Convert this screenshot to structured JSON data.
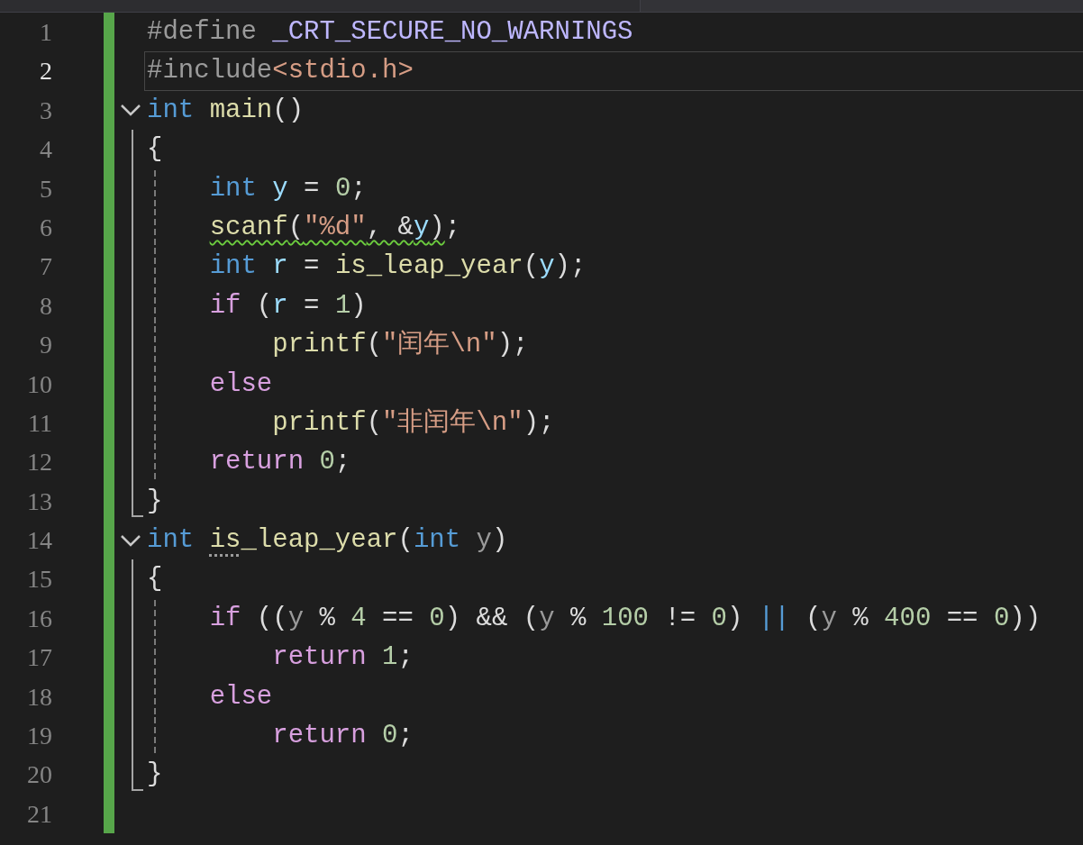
{
  "editor": {
    "lines": [
      {
        "number": "1",
        "current": false,
        "indent_guide": false,
        "tokens": [
          {
            "kind": "pp",
            "text": "#define "
          },
          {
            "kind": "macro",
            "text": "_CRT_SECURE_NO_WARNINGS"
          }
        ]
      },
      {
        "number": "2",
        "current": true,
        "indent_guide": false,
        "tokens": [
          {
            "kind": "pp",
            "text": "#include"
          },
          {
            "kind": "str",
            "text": "<stdio.h>"
          }
        ]
      },
      {
        "number": "3",
        "current": false,
        "indent_guide": false,
        "expanded": true,
        "tokens": [
          {
            "kind": "kw",
            "text": "int "
          },
          {
            "kind": "fn",
            "text": "main"
          },
          {
            "kind": "txt",
            "text": "()"
          }
        ],
        "children": [
          {
            "number": "4",
            "current": false,
            "indent_guide": false,
            "tokens": [
              {
                "kind": "txt",
                "text": "{"
              }
            ]
          },
          {
            "number": "5",
            "current": false,
            "indent_guide": true,
            "tokens": [
              {
                "kind": "kw",
                "text": "    int "
              },
              {
                "kind": "var",
                "text": "y"
              },
              {
                "kind": "txt",
                "text": " = "
              },
              {
                "kind": "num",
                "text": "0"
              },
              {
                "kind": "txt",
                "text": ";"
              }
            ]
          },
          {
            "number": "6",
            "current": false,
            "indent_guide": true,
            "tokens": [
              {
                "kind": "fn",
                "text": "    scanf",
                "warning": true
              },
              {
                "kind": "txt",
                "text": "(",
                "warning": true
              },
              {
                "kind": "str",
                "text": "\"%d\"",
                "warning": true
              },
              {
                "kind": "txt",
                "text": ", &",
                "warning": true
              },
              {
                "kind": "var",
                "text": "y",
                "warning": true
              },
              {
                "kind": "txt",
                "text": ")",
                "warning": true
              },
              {
                "kind": "txt",
                "text": ";",
                "warning": false
              }
            ]
          },
          {
            "number": "7",
            "current": false,
            "indent_guide": true,
            "tokens": [
              {
                "kind": "kw",
                "text": "    int "
              },
              {
                "kind": "var",
                "text": "r"
              },
              {
                "kind": "txt",
                "text": " = "
              },
              {
                "kind": "fn",
                "text": "is_leap_year"
              },
              {
                "kind": "txt",
                "text": "("
              },
              {
                "kind": "var",
                "text": "y"
              },
              {
                "kind": "txt",
                "text": ");"
              }
            ]
          },
          {
            "number": "8",
            "current": false,
            "indent_guide": true,
            "tokens": [
              {
                "kind": "ctl",
                "text": "    if"
              },
              {
                "kind": "txt",
                "text": " ("
              },
              {
                "kind": "var",
                "text": "r"
              },
              {
                "kind": "txt",
                "text": " = "
              },
              {
                "kind": "num",
                "text": "1"
              },
              {
                "kind": "txt",
                "text": ")"
              }
            ]
          },
          {
            "number": "9",
            "current": false,
            "indent_guide": true,
            "tokens": [
              {
                "kind": "fn",
                "text": "        printf"
              },
              {
                "kind": "txt",
                "text": "("
              },
              {
                "kind": "str",
                "text": "\"闰年\\n\""
              },
              {
                "kind": "txt",
                "text": ");"
              }
            ]
          },
          {
            "number": "10",
            "current": false,
            "indent_guide": true,
            "tokens": [
              {
                "kind": "ctl",
                "text": "    else"
              }
            ]
          },
          {
            "number": "11",
            "current": false,
            "indent_guide": true,
            "tokens": [
              {
                "kind": "fn",
                "text": "        printf"
              },
              {
                "kind": "txt",
                "text": "("
              },
              {
                "kind": "str",
                "text": "\"非闰年\\n\""
              },
              {
                "kind": "txt",
                "text": ");"
              }
            ]
          },
          {
            "number": "12",
            "current": false,
            "indent_guide": true,
            "tokens": [
              {
                "kind": "ctl",
                "text": "    return "
              },
              {
                "kind": "num",
                "text": "0"
              },
              {
                "kind": "txt",
                "text": ";"
              }
            ]
          },
          {
            "number": "13",
            "current": false,
            "indent_guide": false,
            "tokens": [
              {
                "kind": "txt",
                "text": "}"
              }
            ]
          }
        ]
      },
      {
        "number": "14",
        "current": false,
        "indent_guide": false,
        "expanded": true,
        "tokens": [
          {
            "kind": "kw",
            "text": "int ",
            "hint": false
          },
          {
            "kind": "fn",
            "text": "is",
            "hint": true
          },
          {
            "kind": "fn",
            "text": "_leap_year",
            "hint": false
          },
          {
            "kind": "txt",
            "text": "(",
            "hint": false
          },
          {
            "kind": "kw",
            "text": "int ",
            "hint": false
          },
          {
            "kind": "param",
            "text": "y",
            "hint": false
          },
          {
            "kind": "txt",
            "text": ")",
            "hint": false
          }
        ],
        "children": [
          {
            "number": "15",
            "current": false,
            "indent_guide": false,
            "tokens": [
              {
                "kind": "txt",
                "text": "{"
              }
            ]
          },
          {
            "number": "16",
            "current": false,
            "indent_guide": true,
            "tokens": [
              {
                "kind": "ctl",
                "text": "    if"
              },
              {
                "kind": "txt",
                "text": " (("
              },
              {
                "kind": "param",
                "text": "y"
              },
              {
                "kind": "txt",
                "text": " % "
              },
              {
                "kind": "num",
                "text": "4"
              },
              {
                "kind": "txt",
                "text": " == "
              },
              {
                "kind": "num",
                "text": "0"
              },
              {
                "kind": "txt",
                "text": ") && ("
              },
              {
                "kind": "param",
                "text": "y"
              },
              {
                "kind": "txt",
                "text": " % "
              },
              {
                "kind": "num",
                "text": "100"
              },
              {
                "kind": "txt",
                "text": " != "
              },
              {
                "kind": "num",
                "text": "0"
              },
              {
                "kind": "txt",
                "text": ") "
              },
              {
                "kind": "kw",
                "text": "||"
              },
              {
                "kind": "txt",
                "text": " ("
              },
              {
                "kind": "param",
                "text": "y"
              },
              {
                "kind": "txt",
                "text": " % "
              },
              {
                "kind": "num",
                "text": "400"
              },
              {
                "kind": "txt",
                "text": " == "
              },
              {
                "kind": "num",
                "text": "0"
              },
              {
                "kind": "txt",
                "text": "))"
              }
            ]
          },
          {
            "number": "17",
            "current": false,
            "indent_guide": true,
            "tokens": [
              {
                "kind": "ctl",
                "text": "        return "
              },
              {
                "kind": "num",
                "text": "1"
              },
              {
                "kind": "txt",
                "text": ";"
              }
            ]
          },
          {
            "number": "18",
            "current": false,
            "indent_guide": true,
            "tokens": [
              {
                "kind": "ctl",
                "text": "    else"
              }
            ]
          },
          {
            "number": "19",
            "current": false,
            "indent_guide": true,
            "tokens": [
              {
                "kind": "ctl",
                "text": "        return "
              },
              {
                "kind": "num",
                "text": "0"
              },
              {
                "kind": "txt",
                "text": ";"
              }
            ]
          },
          {
            "number": "20",
            "current": false,
            "indent_guide": false,
            "tokens": [
              {
                "kind": "txt",
                "text": "}"
              }
            ]
          }
        ]
      },
      {
        "number": "21",
        "current": false
      }
    ]
  }
}
